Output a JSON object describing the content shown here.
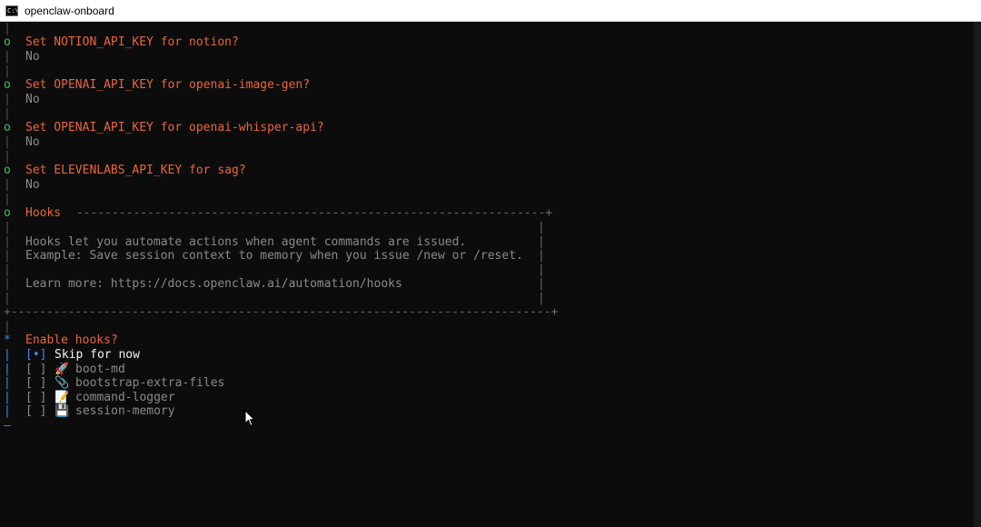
{
  "window": {
    "title": "openclaw-onboard",
    "icon_glyph": "C:\\"
  },
  "prompts": [
    {
      "question": "Set NOTION_API_KEY for notion?",
      "answer": "No"
    },
    {
      "question": "Set OPENAI_API_KEY for openai-image-gen?",
      "answer": "No"
    },
    {
      "question": "Set OPENAI_API_KEY for openai-whisper-api?",
      "answer": "No"
    },
    {
      "question": "Set ELEVENLABS_API_KEY for sag?",
      "answer": "No"
    }
  ],
  "hooks_box": {
    "title": "Hooks",
    "line1": "Hooks let you automate actions when agent commands are issued.",
    "line2": "Example: Save session context to memory when you issue /new or /reset.",
    "learn_more": "Learn more: https://docs.openclaw.ai/automation/hooks"
  },
  "enable_hooks": {
    "question": "Enable hooks?",
    "options": [
      {
        "checkbox": "[•]",
        "emoji": "",
        "label": "Skip for now",
        "selected": true
      },
      {
        "checkbox": "[ ]",
        "emoji": "🚀",
        "label": "boot-md",
        "selected": false
      },
      {
        "checkbox": "[ ]",
        "emoji": "📎",
        "label": "bootstrap-extra-files",
        "selected": false
      },
      {
        "checkbox": "[ ]",
        "emoji": "📝",
        "label": "command-logger",
        "selected": false
      },
      {
        "checkbox": "[ ]",
        "emoji": "💾",
        "label": "session-memory",
        "selected": false
      }
    ]
  },
  "gutter": {
    "bar": "|",
    "done": "o",
    "active": "*",
    "end": "—",
    "corner": "+"
  },
  "colors": {
    "background": "#0c0c0c",
    "question": "#e8663a",
    "answer": "#8a8a8a",
    "done_marker": "#3fbf5f",
    "active": "#3b8eea"
  }
}
